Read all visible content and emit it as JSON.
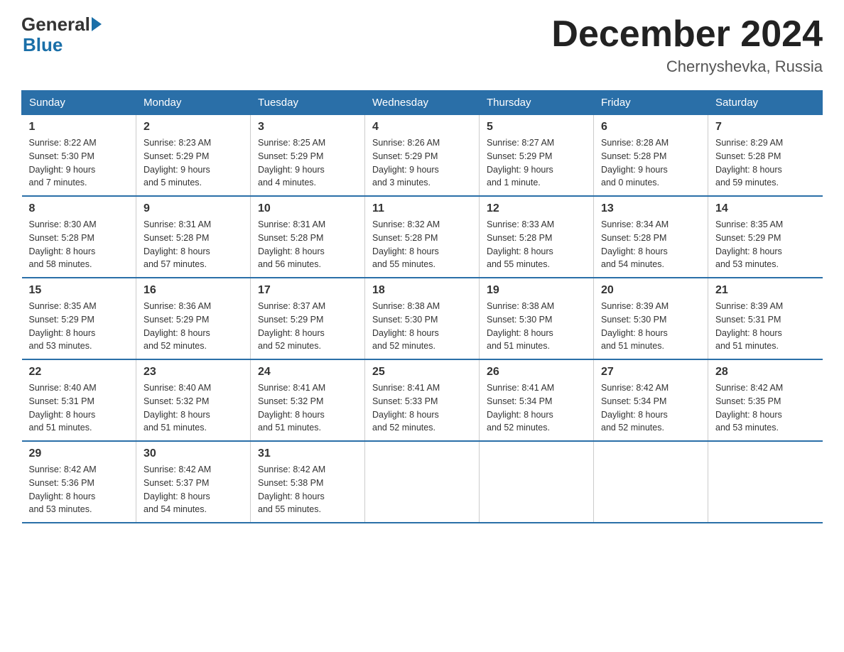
{
  "logo": {
    "text_general": "General",
    "text_blue": "Blue"
  },
  "title": "December 2024",
  "subtitle": "Chernyshevka, Russia",
  "days_header": [
    "Sunday",
    "Monday",
    "Tuesday",
    "Wednesday",
    "Thursday",
    "Friday",
    "Saturday"
  ],
  "weeks": [
    [
      {
        "day": "1",
        "sunrise": "8:22 AM",
        "sunset": "5:30 PM",
        "daylight": "9 hours and 7 minutes."
      },
      {
        "day": "2",
        "sunrise": "8:23 AM",
        "sunset": "5:29 PM",
        "daylight": "9 hours and 5 minutes."
      },
      {
        "day": "3",
        "sunrise": "8:25 AM",
        "sunset": "5:29 PM",
        "daylight": "9 hours and 4 minutes."
      },
      {
        "day": "4",
        "sunrise": "8:26 AM",
        "sunset": "5:29 PM",
        "daylight": "9 hours and 3 minutes."
      },
      {
        "day": "5",
        "sunrise": "8:27 AM",
        "sunset": "5:29 PM",
        "daylight": "9 hours and 1 minute."
      },
      {
        "day": "6",
        "sunrise": "8:28 AM",
        "sunset": "5:28 PM",
        "daylight": "9 hours and 0 minutes."
      },
      {
        "day": "7",
        "sunrise": "8:29 AM",
        "sunset": "5:28 PM",
        "daylight": "8 hours and 59 minutes."
      }
    ],
    [
      {
        "day": "8",
        "sunrise": "8:30 AM",
        "sunset": "5:28 PM",
        "daylight": "8 hours and 58 minutes."
      },
      {
        "day": "9",
        "sunrise": "8:31 AM",
        "sunset": "5:28 PM",
        "daylight": "8 hours and 57 minutes."
      },
      {
        "day": "10",
        "sunrise": "8:31 AM",
        "sunset": "5:28 PM",
        "daylight": "8 hours and 56 minutes."
      },
      {
        "day": "11",
        "sunrise": "8:32 AM",
        "sunset": "5:28 PM",
        "daylight": "8 hours and 55 minutes."
      },
      {
        "day": "12",
        "sunrise": "8:33 AM",
        "sunset": "5:28 PM",
        "daylight": "8 hours and 55 minutes."
      },
      {
        "day": "13",
        "sunrise": "8:34 AM",
        "sunset": "5:28 PM",
        "daylight": "8 hours and 54 minutes."
      },
      {
        "day": "14",
        "sunrise": "8:35 AM",
        "sunset": "5:29 PM",
        "daylight": "8 hours and 53 minutes."
      }
    ],
    [
      {
        "day": "15",
        "sunrise": "8:35 AM",
        "sunset": "5:29 PM",
        "daylight": "8 hours and 53 minutes."
      },
      {
        "day": "16",
        "sunrise": "8:36 AM",
        "sunset": "5:29 PM",
        "daylight": "8 hours and 52 minutes."
      },
      {
        "day": "17",
        "sunrise": "8:37 AM",
        "sunset": "5:29 PM",
        "daylight": "8 hours and 52 minutes."
      },
      {
        "day": "18",
        "sunrise": "8:38 AM",
        "sunset": "5:30 PM",
        "daylight": "8 hours and 52 minutes."
      },
      {
        "day": "19",
        "sunrise": "8:38 AM",
        "sunset": "5:30 PM",
        "daylight": "8 hours and 51 minutes."
      },
      {
        "day": "20",
        "sunrise": "8:39 AM",
        "sunset": "5:30 PM",
        "daylight": "8 hours and 51 minutes."
      },
      {
        "day": "21",
        "sunrise": "8:39 AM",
        "sunset": "5:31 PM",
        "daylight": "8 hours and 51 minutes."
      }
    ],
    [
      {
        "day": "22",
        "sunrise": "8:40 AM",
        "sunset": "5:31 PM",
        "daylight": "8 hours and 51 minutes."
      },
      {
        "day": "23",
        "sunrise": "8:40 AM",
        "sunset": "5:32 PM",
        "daylight": "8 hours and 51 minutes."
      },
      {
        "day": "24",
        "sunrise": "8:41 AM",
        "sunset": "5:32 PM",
        "daylight": "8 hours and 51 minutes."
      },
      {
        "day": "25",
        "sunrise": "8:41 AM",
        "sunset": "5:33 PM",
        "daylight": "8 hours and 52 minutes."
      },
      {
        "day": "26",
        "sunrise": "8:41 AM",
        "sunset": "5:34 PM",
        "daylight": "8 hours and 52 minutes."
      },
      {
        "day": "27",
        "sunrise": "8:42 AM",
        "sunset": "5:34 PM",
        "daylight": "8 hours and 52 minutes."
      },
      {
        "day": "28",
        "sunrise": "8:42 AM",
        "sunset": "5:35 PM",
        "daylight": "8 hours and 53 minutes."
      }
    ],
    [
      {
        "day": "29",
        "sunrise": "8:42 AM",
        "sunset": "5:36 PM",
        "daylight": "8 hours and 53 minutes."
      },
      {
        "day": "30",
        "sunrise": "8:42 AM",
        "sunset": "5:37 PM",
        "daylight": "8 hours and 54 minutes."
      },
      {
        "day": "31",
        "sunrise": "8:42 AM",
        "sunset": "5:38 PM",
        "daylight": "8 hours and 55 minutes."
      },
      null,
      null,
      null,
      null
    ]
  ],
  "labels": {
    "sunrise": "Sunrise:",
    "sunset": "Sunset:",
    "daylight": "Daylight:"
  }
}
